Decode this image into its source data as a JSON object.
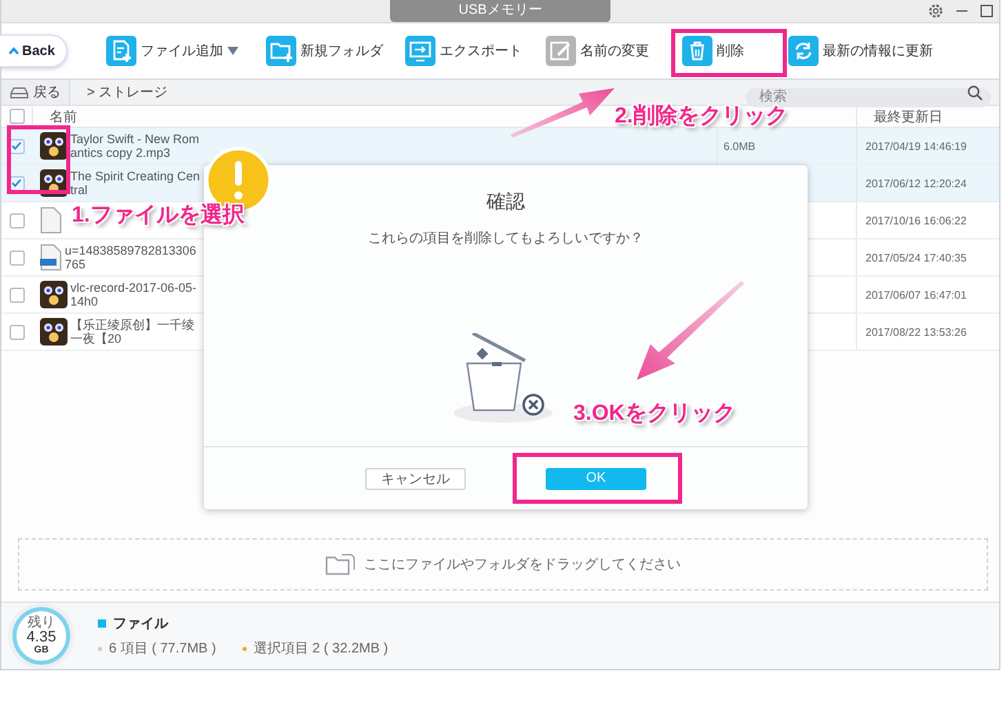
{
  "window": {
    "title": "USBメモリー"
  },
  "toolbar": {
    "back": "Back",
    "items": [
      {
        "kind": "add-file",
        "label": "ファイル追加",
        "dropdown": true,
        "disabled": false
      },
      {
        "kind": "new-folder",
        "label": "新規フォルダ",
        "dropdown": false,
        "disabled": false
      },
      {
        "kind": "export",
        "label": "エクスポート",
        "dropdown": false,
        "disabled": false
      },
      {
        "kind": "rename",
        "label": "名前の変更",
        "dropdown": false,
        "disabled": true
      },
      {
        "kind": "delete",
        "label": "削除",
        "dropdown": false,
        "disabled": false
      },
      {
        "kind": "refresh",
        "label": "最新の情報に更新",
        "dropdown": false,
        "disabled": false
      }
    ]
  },
  "path_bar": {
    "back": "戻る",
    "path": "> ストレージ",
    "search": {
      "placeholder": "検索"
    }
  },
  "table": {
    "columns": [
      "名前",
      "最終更新日"
    ],
    "all_checked": false,
    "rows": [
      {
        "kind": "media",
        "name": "Taylor Swift - New Romantics copy 2.mp3",
        "size": "6.0MB",
        "modified": "2017/04/19 14:46:19",
        "checked": true,
        "selected": true
      },
      {
        "kind": "media",
        "name": "The Spirit Creating Central",
        "modified": "2017/06/12 12:20:24",
        "checked": true,
        "selected": true
      },
      {
        "kind": "document",
        "modified": "2017/10/16 16:06:22",
        "checked": false,
        "selected": false
      },
      {
        "kind": "image",
        "name": "u=14838589782813306765",
        "modified": "2017/05/24 17:40:35",
        "checked": false,
        "selected": false
      },
      {
        "kind": "media",
        "name": "vlc-record-2017-06-05-14h0",
        "modified": "2017/06/07 16:47:01",
        "checked": false,
        "selected": false
      },
      {
        "kind": "media",
        "name": "【乐正绫原创】一千绫一夜【20",
        "modified": "2017/08/22 13:53:26",
        "checked": false,
        "selected": false
      }
    ]
  },
  "drop_zone": "ここにファイルやフォルダをドラッグしてください",
  "storage": {
    "label": "残り",
    "value": "4.35",
    "unit": "GB"
  },
  "footer": {
    "legend": "ファイル",
    "count": "6 項目 ( 77.7MB )",
    "selection": "選択項目 2 ( 32.2MB )"
  },
  "dialog": {
    "title": "確認",
    "message": "これらの項目を削除してもよろしいですか？",
    "buttons": [
      {
        "kind": "secondary",
        "label": "キャンセル"
      },
      {
        "kind": "primary",
        "label": "OK"
      }
    ]
  },
  "annotations": [
    {
      "kind": "step",
      "text": "1.ファイルを選択"
    },
    {
      "kind": "step",
      "text": "2.削除をクリック"
    },
    {
      "kind": "step",
      "text": "3.OKをクリック"
    }
  ]
}
